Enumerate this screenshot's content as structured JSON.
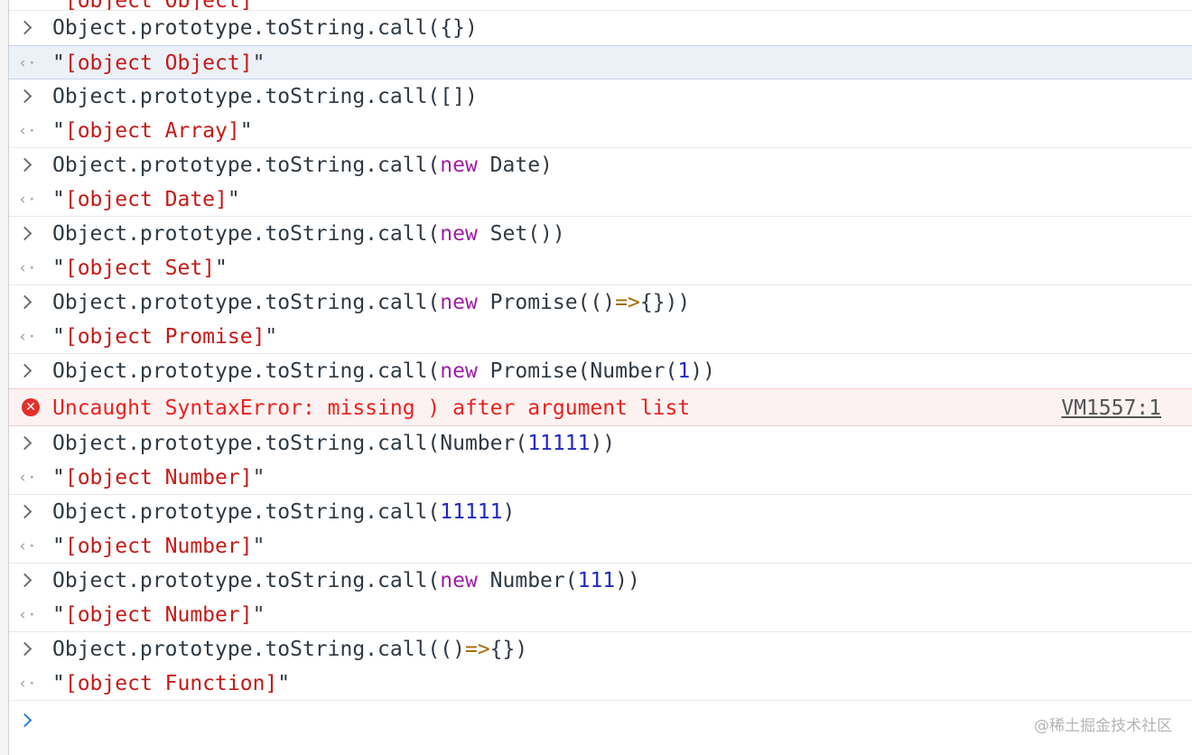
{
  "partial_top_text": "\"[object Object]\"",
  "entries": [
    {
      "input": [
        "Object.prototype.toString.call({})"
      ],
      "output": "[object Object]"
    },
    {
      "input": [
        "Object.prototype.toString.call([])"
      ],
      "output": "[object Array]"
    },
    {
      "input_prefix": "Object.prototype.toString.call(",
      "keyword": "new",
      "input_rest": " Date)",
      "output": "[object Date]"
    },
    {
      "input_prefix": "Object.prototype.toString.call(",
      "keyword": "new",
      "input_rest": " Set())",
      "output": "[object Set]"
    },
    {
      "input_prefix": "Object.prototype.toString.call(",
      "keyword": "new",
      "input_mid": " Promise(()",
      "arrow": "=>",
      "input_rest": "{}))",
      "output": "[object Promise]"
    },
    {
      "input_prefix": "Object.prototype.toString.call(",
      "keyword": "new",
      "input_mid": " Promise(Number(",
      "number": "1",
      "input_rest": "))"
    },
    {
      "input_prefix": "Object.prototype.toString.call(Number(",
      "number": "11111",
      "input_rest": "))",
      "output": "[object Number]"
    },
    {
      "input_prefix": "Object.prototype.toString.call(",
      "number": "11111",
      "input_rest": ")",
      "output": "[object Number]"
    },
    {
      "input_prefix": "Object.prototype.toString.call(",
      "keyword": "new",
      "input_mid": " Number(",
      "number": "111",
      "input_rest": "))",
      "output": "[object Number]"
    },
    {
      "input_prefix": "Object.prototype.toString.call(()",
      "arrow": "=>",
      "input_rest": "{})",
      "output": "[object Function]"
    }
  ],
  "error": {
    "message": "Uncaught SyntaxError: missing ) after argument list",
    "source_link": "VM1557:1"
  },
  "quote": "\"",
  "icons": {
    "input_chevron": "chevron-right-icon",
    "output_arrow": "return-arrow-icon",
    "error": "error-circle-icon",
    "prompt": "prompt-chevron-icon"
  },
  "watermark": "@稀土掘金技术社区",
  "colors": {
    "keyword": "#9d1fa3",
    "number": "#1f28c7",
    "string": "#c41a16",
    "arrow": "#a66a00",
    "error_text": "#e8221d",
    "error_bg": "#fdf2f2",
    "highlight_bg": "#ecf1f8"
  }
}
